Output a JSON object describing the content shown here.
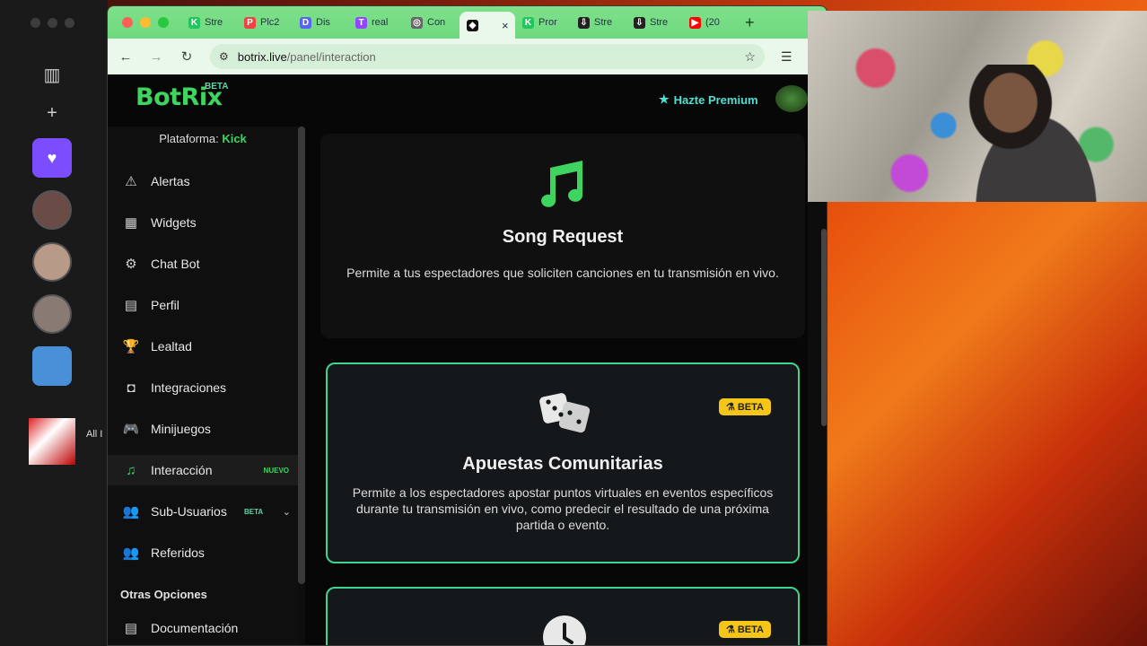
{
  "browser": {
    "tabs": [
      {
        "label": "Stre",
        "fav_color": "#22c55e",
        "fav_char": "K"
      },
      {
        "label": "Plc2",
        "fav_color": "#ef4444",
        "fav_char": "P"
      },
      {
        "label": "Dis",
        "fav_color": "#5865f2",
        "fav_char": "D"
      },
      {
        "label": "real",
        "fav_color": "#9146ff",
        "fav_char": "T"
      },
      {
        "label": "Con",
        "fav_color": "#666666",
        "fav_char": "◎"
      },
      {
        "label": "",
        "fav_color": "#111111",
        "fav_char": "◆"
      },
      {
        "label": "Pror",
        "fav_color": "#22c55e",
        "fav_char": "K"
      },
      {
        "label": "Stre",
        "fav_color": "#222222",
        "fav_char": "⇩"
      },
      {
        "label": "Stre",
        "fav_color": "#222222",
        "fav_char": "⇩"
      },
      {
        "label": "(20",
        "fav_color": "#ff0000",
        "fav_char": "▶"
      }
    ],
    "active_tab_close": "×",
    "new_tab": "+",
    "url_domain": "botrix.live",
    "url_path": "/panel/interaction"
  },
  "header": {
    "logo": "BotRix",
    "logo_badge": "BETA",
    "premium_label": "Hazte Premium"
  },
  "sidebar": {
    "platform_label": "Plataforma:",
    "platform_value": "Kick",
    "items": [
      {
        "label": "Alertas",
        "icon": "warning-icon",
        "glyph": "⚠"
      },
      {
        "label": "Widgets",
        "icon": "widgets-icon",
        "glyph": "▦"
      },
      {
        "label": "Chat Bot",
        "icon": "robot-icon",
        "glyph": "⚙"
      },
      {
        "label": "Perfil",
        "icon": "id-card-icon",
        "glyph": "▤"
      },
      {
        "label": "Lealtad",
        "icon": "trophy-icon",
        "glyph": "🏆"
      },
      {
        "label": "Integraciones",
        "icon": "integrations-icon",
        "glyph": "◘"
      },
      {
        "label": "Minijuegos",
        "icon": "gamepad-icon",
        "glyph": "🎮"
      },
      {
        "label": "Interacción",
        "icon": "music-icon",
        "glyph": "♫",
        "badge": "NUEVO"
      },
      {
        "label": "Sub-Usuarios",
        "icon": "users-icon",
        "glyph": "👥",
        "badge": "BETA"
      },
      {
        "label": "Referidos",
        "icon": "referrals-icon",
        "glyph": "👥"
      }
    ],
    "other_options": "Otras Opciones",
    "docs_label": "Documentación"
  },
  "cards": [
    {
      "title": "Song Request",
      "description": "Permite a tus espectadores que soliciten canciones en tu transmisión en vivo.",
      "icon": "music-note-icon"
    },
    {
      "title": "Apuestas Comunitarias",
      "description": "Permite a los espectadores apostar puntos virtuales en eventos específicos durante tu transmisión en vivo, como predecir el resultado de una próxima partida o evento.",
      "icon": "dice-icon",
      "badge": "BETA"
    },
    {
      "icon": "clock-icon",
      "badge": "BETA"
    }
  ],
  "background_app": {
    "album_text": "All I"
  },
  "colors": {
    "accent_green": "#3fd45f",
    "teal": "#4fe0d0",
    "beta_yellow": "#f5c518",
    "card_border": "#3fd48f"
  }
}
